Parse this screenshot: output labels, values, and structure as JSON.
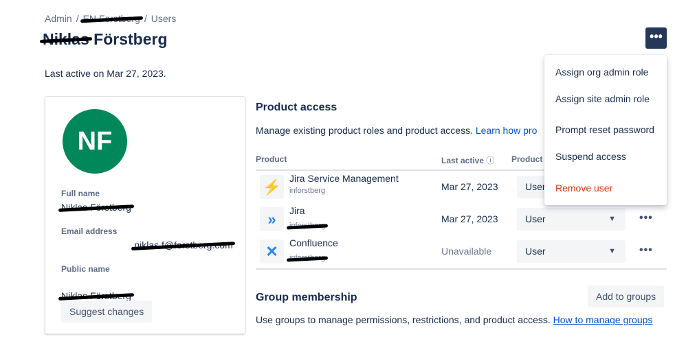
{
  "breadcrumb": [
    "Admin",
    "/",
    "EN Forstberg",
    "/",
    "Users"
  ],
  "page_title": {
    "redacted": "Niklas",
    "visible": "Förstberg"
  },
  "last_active": "Last active on Mar 27, 2023.",
  "profile": {
    "initials": "NF",
    "avatar_color": "#00875a",
    "full_name_label": "Full name",
    "full_name": "Niklas Förstberg",
    "email_label": "Email address",
    "email": "niklas.f@forstberg.com",
    "public_name_label": "Public name",
    "public_name": "Niklas Förstberg",
    "suggest_button": "Suggest changes"
  },
  "product_access": {
    "title": "Product access",
    "description": "Manage existing product roles and product access.",
    "link": "Learn how pro",
    "columns": [
      "Product",
      "Last active",
      "Product"
    ],
    "rows": [
      {
        "icon": "jira-service-management-icon",
        "glyph": "⚡",
        "name": "Jira Service Management",
        "site": "inforstberg",
        "last_active": "Mar 27, 2023",
        "role": "User"
      },
      {
        "icon": "jira-icon",
        "glyph": "»",
        "name": "Jira",
        "site": "inforstberg",
        "last_active": "Mar 27, 2023",
        "role": "User"
      },
      {
        "icon": "confluence-icon",
        "glyph": "✕",
        "name": "Confluence",
        "site": "inforstberg",
        "last_active": "Unavailable",
        "role": "User"
      }
    ]
  },
  "group_membership": {
    "title": "Group membership",
    "add_button": "Add to groups",
    "description": "Use groups to manage permissions, restrictions, and product access.",
    "link": "How to manage groups"
  },
  "menu": {
    "items": [
      "Assign org admin role",
      "Assign site admin role",
      "Prompt reset password",
      "Suspend access",
      "Remove user"
    ],
    "danger_color": "#de350b"
  },
  "more_glyph": "•••"
}
